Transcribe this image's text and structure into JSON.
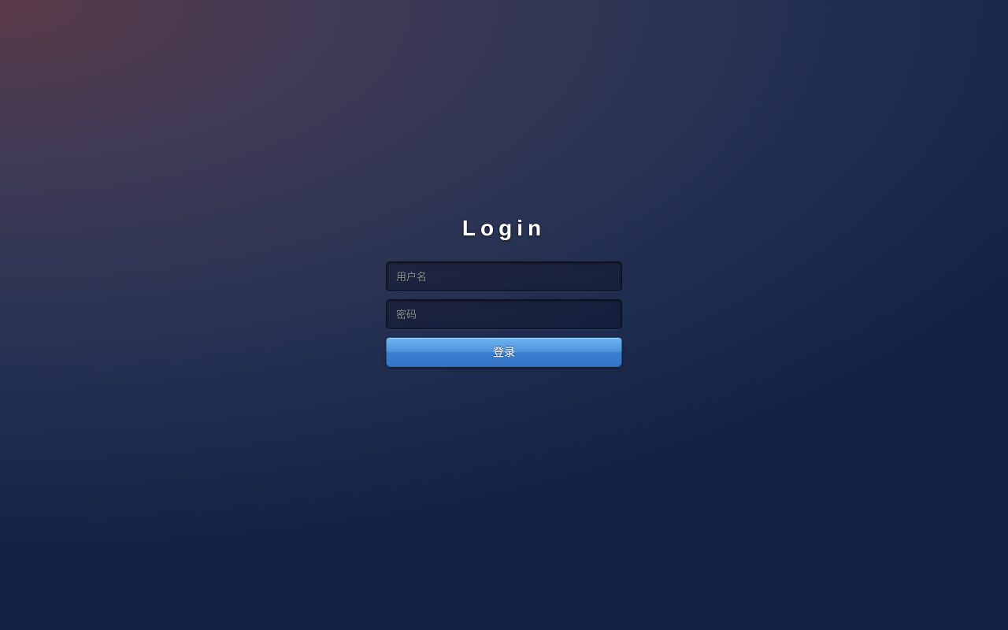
{
  "login": {
    "title": "Login",
    "username_placeholder": "用户名",
    "password_placeholder": "密码",
    "submit_label": "登录"
  }
}
